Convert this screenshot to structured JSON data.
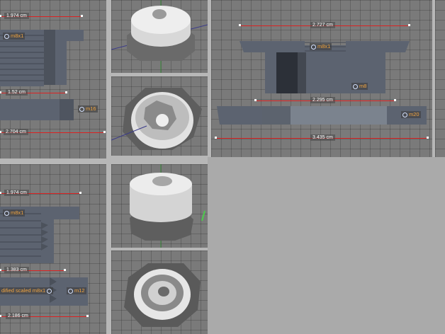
{
  "views": {
    "m16": {
      "top_dim": "1.974 cm",
      "mid_dim": "1.52 cm",
      "bottom_dim": "2.704 cm",
      "tag_top": "m8x1",
      "tag_side": "m16"
    },
    "m20": {
      "top_dim": "2.727 cm",
      "mid_dim": "2.295 cm",
      "bottom_dim": "3.435 cm",
      "tag_top": "m8x1",
      "tag_mid": "m8",
      "tag_side": "m20"
    },
    "m12": {
      "top_dim": "1.974 cm",
      "mid_dim": "1.383 cm",
      "bottom_dim": "2.186 cm",
      "tag_top": "m8x1",
      "tag_bottom": "dified scaled m8x1",
      "tag_side": "m12"
    }
  },
  "colors": {
    "viewport_bg": "#7a7a7a",
    "part_fill": "#5c6370",
    "dimension_line": "#dd2222",
    "tag_text": "#f3a640",
    "empty_area": "#aaaaaa"
  },
  "icons": [
    "anchor-dot-icon",
    "axis-gizmo-icon"
  ]
}
